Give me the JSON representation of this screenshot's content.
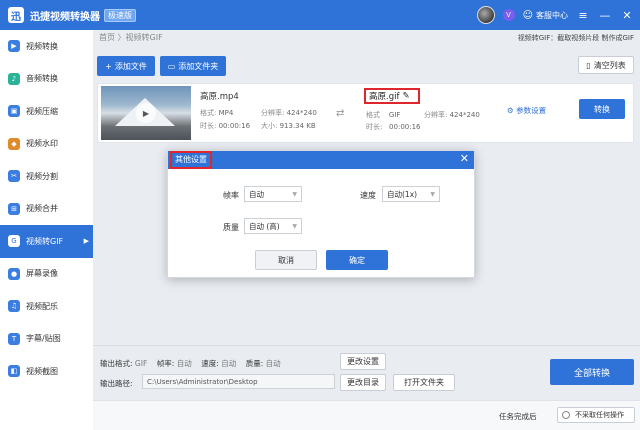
{
  "app": {
    "title": "迅捷视频转换器",
    "badge": "极速版",
    "logo_text": "迅"
  },
  "titlebar": {
    "help_label": "客服中心",
    "vip_text": "V",
    "minimize": "—",
    "close": "✕",
    "menu": "≡"
  },
  "sidebar": {
    "items": [
      {
        "label": "视频转换",
        "icon": "video-convert-icon",
        "color": "#3b7de0",
        "glyph": "▶"
      },
      {
        "label": "音频转换",
        "icon": "audio-icon",
        "color": "#2bb39a",
        "glyph": "♪"
      },
      {
        "label": "视频压缩",
        "icon": "compress-icon",
        "color": "#3b7de0",
        "glyph": "▣"
      },
      {
        "label": "视频水印",
        "icon": "watermark-icon",
        "color": "#e08b2b",
        "glyph": "◆"
      },
      {
        "label": "视频分割",
        "icon": "split-icon",
        "color": "#3b7de0",
        "glyph": "✂"
      },
      {
        "label": "视频合并",
        "icon": "merge-icon",
        "color": "#3b7de0",
        "glyph": "⊞"
      },
      {
        "label": "视频转GIF",
        "icon": "gif-icon",
        "color": "#3b7de0",
        "glyph": "G",
        "active": true
      },
      {
        "label": "屏幕录像",
        "icon": "record-icon",
        "color": "#3b7de0",
        "glyph": "●"
      },
      {
        "label": "视频配乐",
        "icon": "music-icon",
        "color": "#3b7de0",
        "glyph": "♫"
      },
      {
        "label": "字幕/贴图",
        "icon": "subtitle-icon",
        "color": "#3b7de0",
        "glyph": "T"
      },
      {
        "label": "视频截图",
        "icon": "screenshot-icon",
        "color": "#3b7de0",
        "glyph": "◧"
      }
    ],
    "active_arrow": "▶"
  },
  "header": {
    "breadcrumb": "首页 〉视频转GIF",
    "description": "视频转GIF：截取视频片段 制作成GIF"
  },
  "toolbar": {
    "add_file": "添加文件",
    "add_folder": "添加文件夹",
    "clear_list": "清空列表"
  },
  "file": {
    "name": "高原.mp4",
    "format_label": "格式:",
    "format": "MP4",
    "resolution_label": "分辨率:",
    "resolution": "424*240",
    "duration_label": "时长:",
    "duration": "00:00:16",
    "size_label": "大小:",
    "size": "913.34 KB",
    "output_name": "高原.gif",
    "out_format_label": "格式",
    "out_format": "GIF",
    "out_resolution_label": "分辨率:",
    "out_resolution": "424*240",
    "out_duration_label": "时长:",
    "out_duration": "00:00:16",
    "settings_label": "参数设置",
    "convert_label": "转换"
  },
  "modal": {
    "title": "其他设置",
    "close": "✕",
    "frame_rate_label": "帧率",
    "frame_rate": "自动",
    "speed_label": "速度",
    "speed": "自动(1x)",
    "quality_label": "质量",
    "quality": "自动 (高)",
    "cancel": "取消",
    "ok": "确定"
  },
  "bottom": {
    "format_label": "输出格式:",
    "format": "GIF",
    "fps_label": "帧率:",
    "fps": "自动",
    "speed_label": "速度:",
    "speed": "自动",
    "quality_label": "质量:",
    "quality": "自动",
    "change_settings": "更改设置",
    "path_label": "输出路径:",
    "path": "C:\\Users\\Administrator\\Desktop",
    "change_dir": "更改目录",
    "open_folder": "打开文件夹",
    "convert_all": "全部转换"
  },
  "status": {
    "after_label": "任务完成后",
    "after_value": "不采取任何操作"
  }
}
